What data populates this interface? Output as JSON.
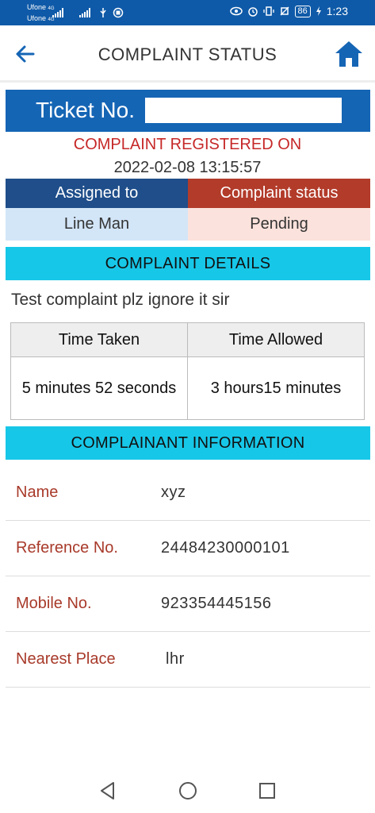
{
  "status_bar": {
    "carrier_line1": "Ufone",
    "carrier_line2": "Ufone",
    "network_1": "4G",
    "network_2": "4G",
    "battery": "86",
    "time": "1:23"
  },
  "header": {
    "title": "COMPLAINT STATUS"
  },
  "ticket": {
    "label": "Ticket No.",
    "value": ""
  },
  "registered": {
    "label": "COMPLAINT REGISTERED ON",
    "date": "2022-02-08 13:15:57"
  },
  "status_table": {
    "assigned_header": "Assigned to",
    "status_header": "Complaint status",
    "assigned_value": "Line Man",
    "status_value": "Pending"
  },
  "details": {
    "header": "COMPLAINT DETAILS",
    "text": "Test complaint plz ignore it sir"
  },
  "time_table": {
    "taken_header": "Time Taken",
    "allowed_header": "Time Allowed",
    "taken_value": "5 minutes 52 seconds",
    "allowed_value": "3 hours15 minutes"
  },
  "complainant": {
    "header": "COMPLAINANT INFORMATION",
    "rows": [
      {
        "label": "Name",
        "value": "xyz"
      },
      {
        "label": "Reference No.",
        "value": "24484230000101"
      },
      {
        "label": "Mobile No.",
        "value": "923354445156"
      },
      {
        "label": "Nearest Place",
        "value": "lhr"
      }
    ]
  },
  "colors": {
    "primary_blue": "#1565b5",
    "status_bar": "#0f5aa8",
    "accent_red": "#c62828",
    "cyan_section": "#17c7e8"
  },
  "icons": {
    "back": "arrow-left-icon",
    "home": "home-icon",
    "nav_back": "triangle-back-icon",
    "nav_home": "circle-home-icon",
    "nav_recent": "square-recent-icon"
  }
}
